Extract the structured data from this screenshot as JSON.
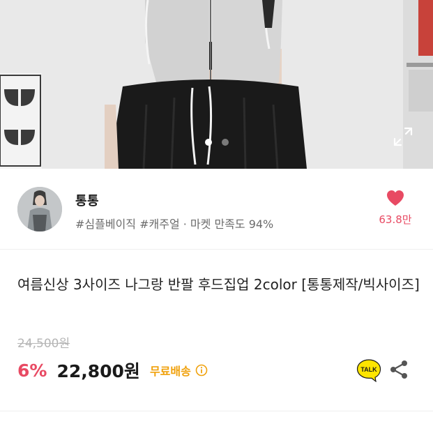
{
  "carousel": {
    "slide_count": 2,
    "active_slide": 1
  },
  "seller": {
    "name": "통통",
    "meta": "#심플베이직 #캐주얼 · 마켓 만족도 94%",
    "likes": "63.8만"
  },
  "product": {
    "title": "여름신상 3사이즈 나그랑 반팔 후드집업 2color [통통제작/빅사이즈]",
    "original_price": "24,500원",
    "discount": "6%",
    "price": "22,800원",
    "shipping": "무료배송"
  },
  "icons": {
    "expand": "expand-icon",
    "heart": "heart-icon",
    "info": "info-icon",
    "kakaotalk": "kakaotalk-icon",
    "share": "share-icon"
  },
  "kakaotalk_label": "TALK",
  "colors": {
    "accent_red": "#e84a63",
    "shipping_orange": "#f0a10c",
    "kakao_yellow": "#fee500"
  }
}
